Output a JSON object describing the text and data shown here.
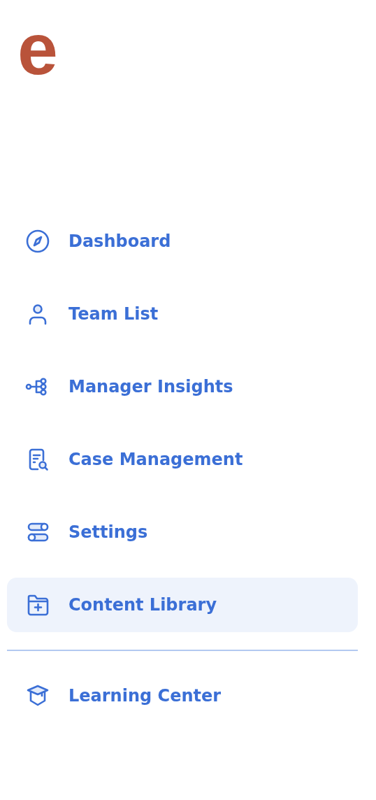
{
  "logo": {
    "text": "e"
  },
  "nav": [
    {
      "label": "Dashboard",
      "selected": false
    },
    {
      "label": "Team List",
      "selected": false
    },
    {
      "label": "Manager Insights",
      "selected": false
    },
    {
      "label": "Case Management",
      "selected": false
    },
    {
      "label": "Settings",
      "selected": false
    },
    {
      "label": "Content Library",
      "selected": true
    }
  ],
  "footer_nav": [
    {
      "label": "Learning Center",
      "selected": false
    }
  ]
}
